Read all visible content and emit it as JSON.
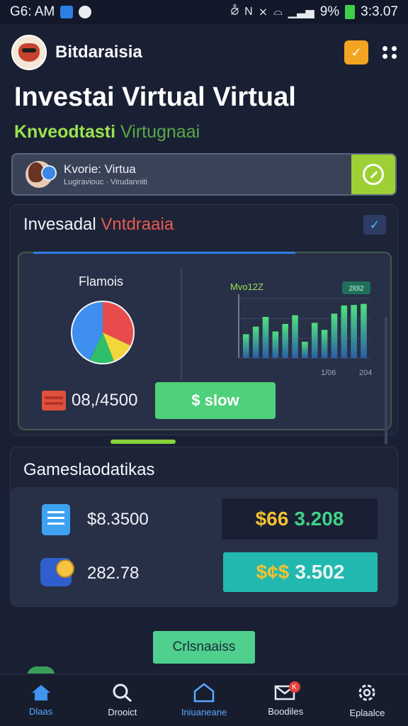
{
  "status_bar": {
    "time": "G6: AM",
    "battery_percent": "9%",
    "clock_right": "3:3.07",
    "icons": [
      "photo-icon",
      "ghost-icon",
      "vibrate-icon",
      "nfc-icon",
      "signal-icon",
      "wifi-icon",
      "cell-signal-icon",
      "battery-icon"
    ]
  },
  "app_bar": {
    "brand": "Bitdaraisia",
    "badge_icon": "v-badge-icon",
    "menu_icon": "kebab-menu-icon"
  },
  "headline": "Investai Virtual Virtual",
  "subhead": {
    "primary": "Knveodtasti",
    "secondary": "Virtugnaai"
  },
  "profile_card": {
    "name": "Kvorie: Virtua",
    "subtitle": "Lugiraviouc · Virudanniti",
    "action_icon": "check-circle-icon"
  },
  "invest_panel": {
    "title_white": "Invesadal",
    "title_red": "Vntdraaia",
    "check_icon": "checkmark-icon",
    "pie_label": "Flamois",
    "amount": "08,/4500",
    "show_button": "$ slow",
    "bar_chart_label": "Mvo12Z",
    "bar_chart_tag": "2l0l2",
    "bar_chart_x_labels": [
      "1/06",
      "204"
    ]
  },
  "games_panel": {
    "title": "Gameslaodatikas",
    "rows": [
      {
        "icon": "document-stack-icon",
        "value": "$8.3500",
        "symbol": "$66",
        "amount": "3.208"
      },
      {
        "icon": "coin-wallet-icon",
        "value": "282.78",
        "symbol": "$¢$",
        "amount": "3.502"
      }
    ]
  },
  "cta_button": "Crlsnaaiss",
  "bottom_nav": [
    {
      "icon": "home-icon",
      "label": "Dlaas"
    },
    {
      "icon": "search-icon",
      "label": "Drooict"
    },
    {
      "icon": "house-outline-icon",
      "label": "Iniuaneane"
    },
    {
      "icon": "mail-icon",
      "label": "Boodiles",
      "badge": "K"
    },
    {
      "icon": "settings-icon",
      "label": "Eplaalce"
    }
  ],
  "colors": {
    "background": "#1a2033",
    "accent_green": "#4fd07a",
    "accent_lime": "#9cd034",
    "accent_red": "#e85a4f",
    "accent_blue": "#58a9ff",
    "accent_orange": "#f3a423"
  },
  "chart_data": [
    {
      "type": "pie",
      "title": "Flamois",
      "values": [
        32,
        12,
        13,
        43
      ],
      "colors": [
        "#e84b4b",
        "#f2d63b",
        "#2fbf6a",
        "#3f8ef0"
      ]
    },
    {
      "type": "bar",
      "title": "Mvo12Z",
      "categories": [
        "1",
        "2",
        "3",
        "4",
        "5",
        "6",
        "7",
        "8",
        "9",
        "10",
        "11",
        "12",
        "13"
      ],
      "values": [
        44,
        58,
        76,
        49,
        63,
        79,
        30,
        65,
        52,
        82,
        97,
        98,
        100
      ],
      "ylim": [
        0,
        110
      ],
      "xlabels": [
        "1/06",
        "204"
      ],
      "tag": "2l0l2"
    }
  ]
}
